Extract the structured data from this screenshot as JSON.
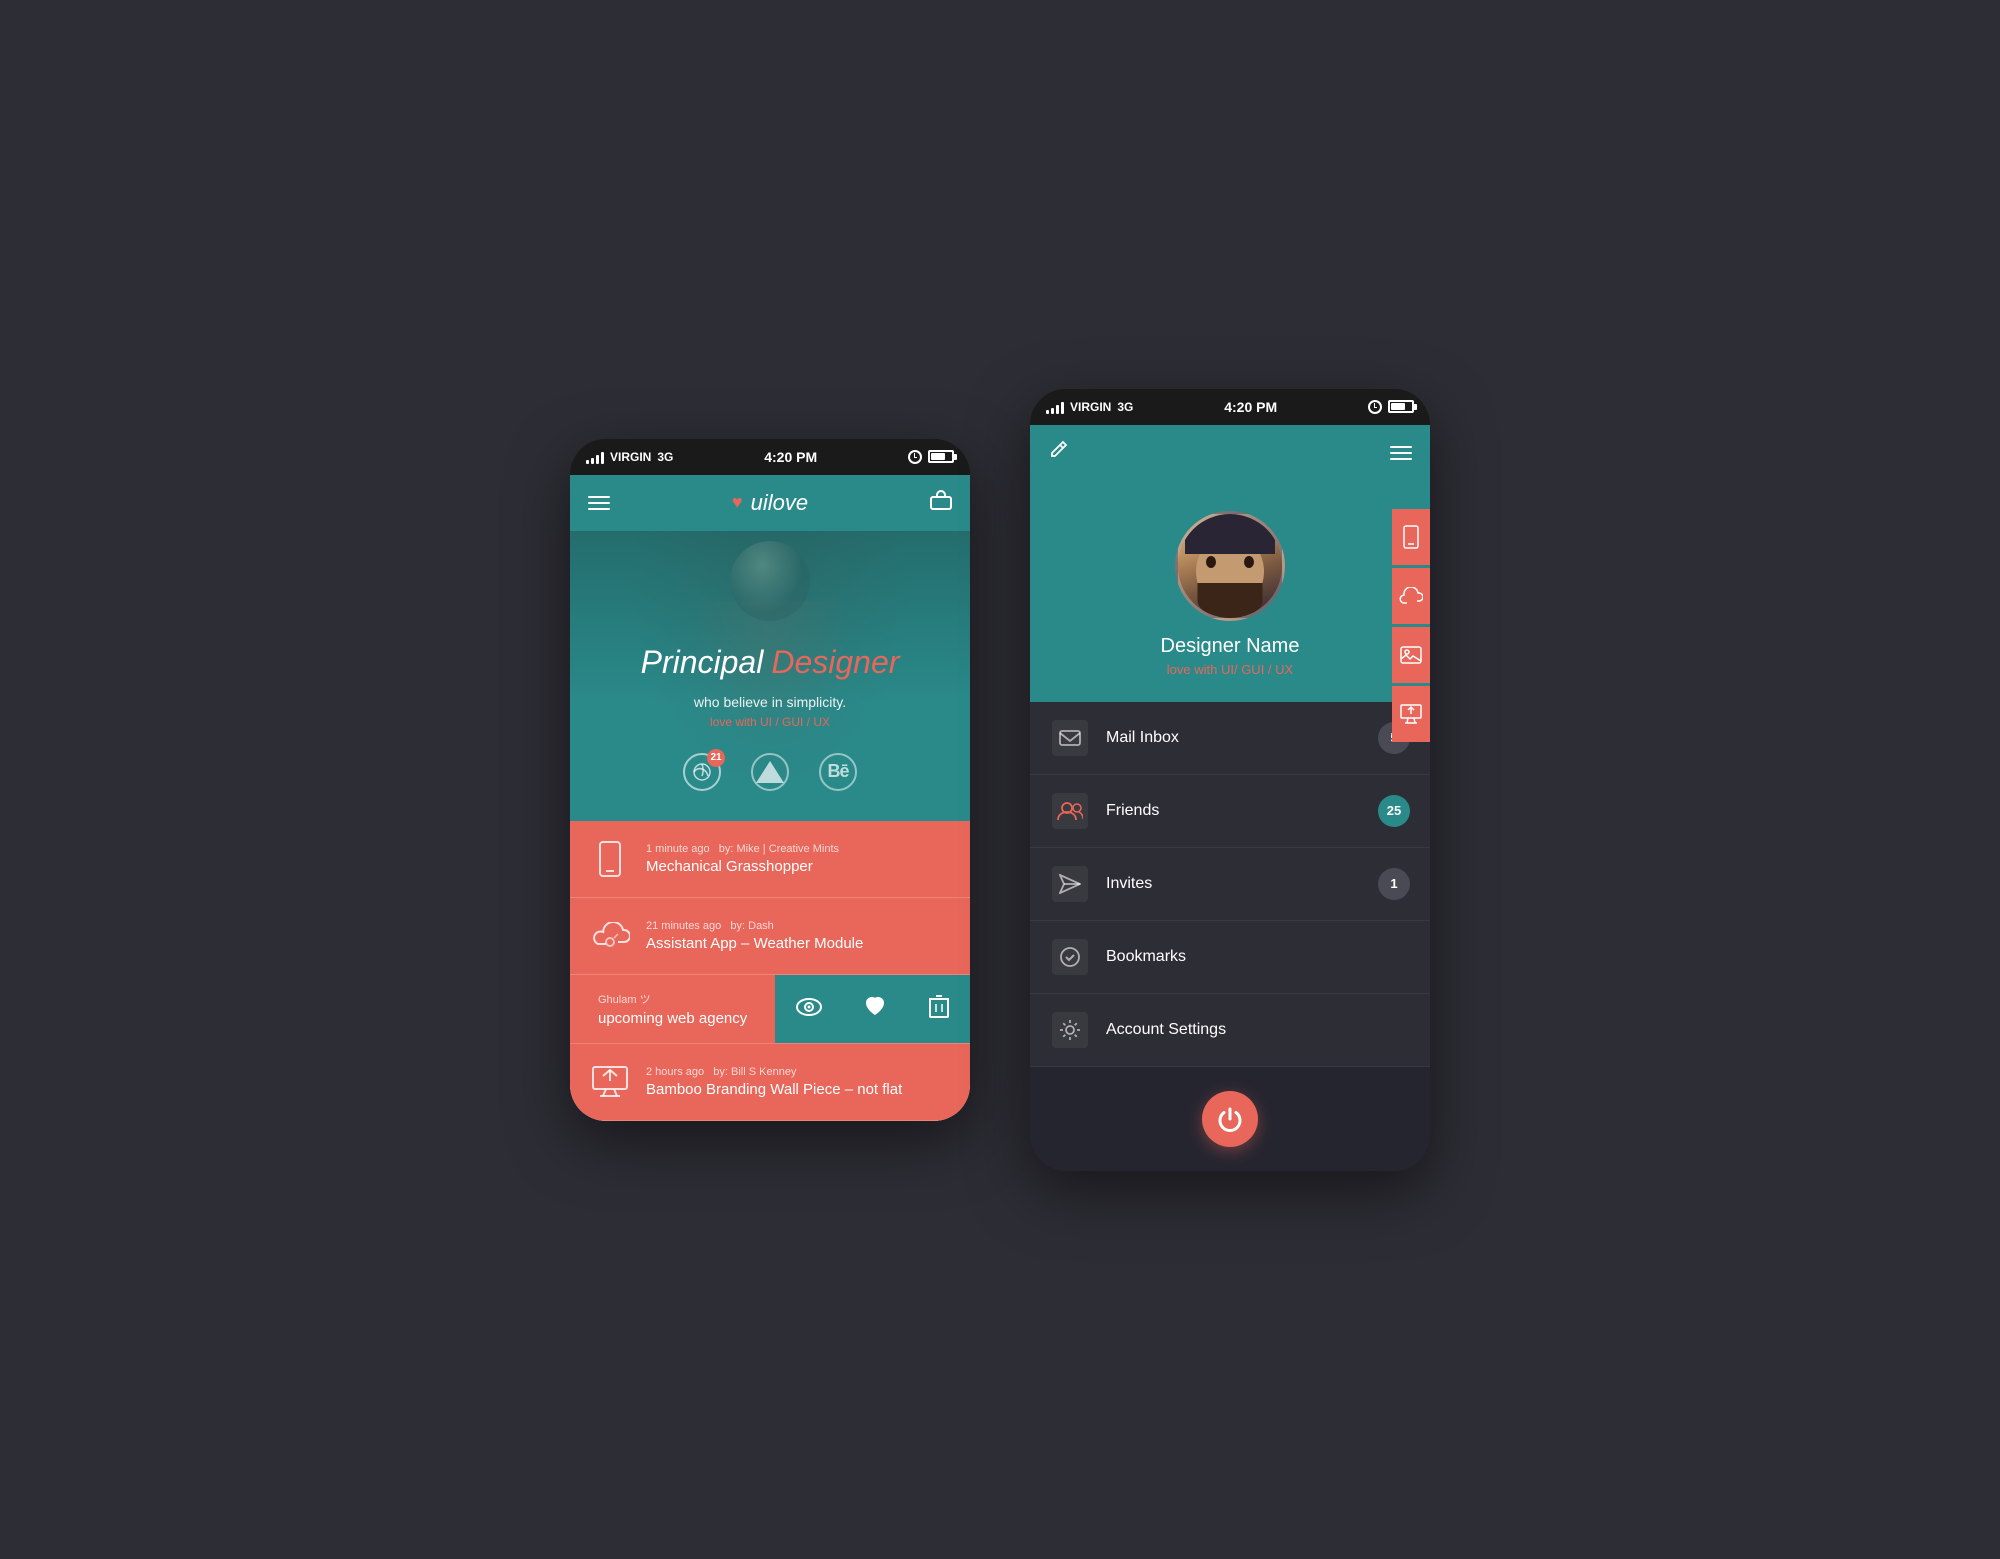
{
  "background_color": "#2d2d35",
  "screen1": {
    "status_bar": {
      "carrier": "VIRGIN",
      "network": "3G",
      "time": "4:20 PM"
    },
    "header": {
      "logo_text": "uilove",
      "menu_icon": "hamburger",
      "action_icon": "briefcase"
    },
    "hero": {
      "title_plain": "Principal",
      "title_accent": "Designer",
      "subtitle": "who believe in simplicity.",
      "subtitle2": "love with UI / GUI / UX",
      "social_icons": [
        {
          "name": "Dribbble",
          "badge": "21"
        },
        {
          "name": "Campaign",
          "badge": null
        },
        {
          "name": "Behance",
          "badge": null
        }
      ]
    },
    "feed_items": [
      {
        "icon_type": "phone",
        "time": "1 minute ago",
        "author": "by: Mike | Creative Mints",
        "title": "Mechanical Grasshopper"
      },
      {
        "icon_type": "cloud",
        "time": "21 minutes ago",
        "author": "by: Dash",
        "title": "Assistant App – Weather Module"
      },
      {
        "icon_type": "swipe_item",
        "author_partial": "Ghulam ツ",
        "title": "upcoming web agency",
        "swipe_actions": [
          "view",
          "like",
          "delete"
        ]
      },
      {
        "icon_type": "monitor",
        "time": "2 hours ago",
        "author": "by: Bill S Kenney",
        "title": "Bamboo Branding Wall Piece – not flat"
      }
    ]
  },
  "screen2": {
    "status_bar": {
      "carrier": "VIRGIN",
      "network": "3G",
      "time": "4:20 PM"
    },
    "header": {
      "edit_icon": "pencil",
      "menu_icon": "hamburger"
    },
    "profile": {
      "name": "Designer Name",
      "subtitle": "love with UI/ GUI / UX"
    },
    "menu_items": [
      {
        "icon_type": "mail",
        "label": "Mail Inbox",
        "badge": "5",
        "badge_style": "default"
      },
      {
        "icon_type": "friends",
        "label": "Friends",
        "badge": "25",
        "badge_style": "teal"
      },
      {
        "icon_type": "invites",
        "label": "Invites",
        "badge": "1",
        "badge_style": "default"
      },
      {
        "icon_type": "bookmark",
        "label": "Bookmarks",
        "badge": null,
        "badge_style": null
      },
      {
        "icon_type": "settings",
        "label": "Account Settings",
        "badge": null,
        "badge_style": null
      }
    ],
    "footer": {
      "button_label": "Logout",
      "button_icon": "eject"
    }
  }
}
